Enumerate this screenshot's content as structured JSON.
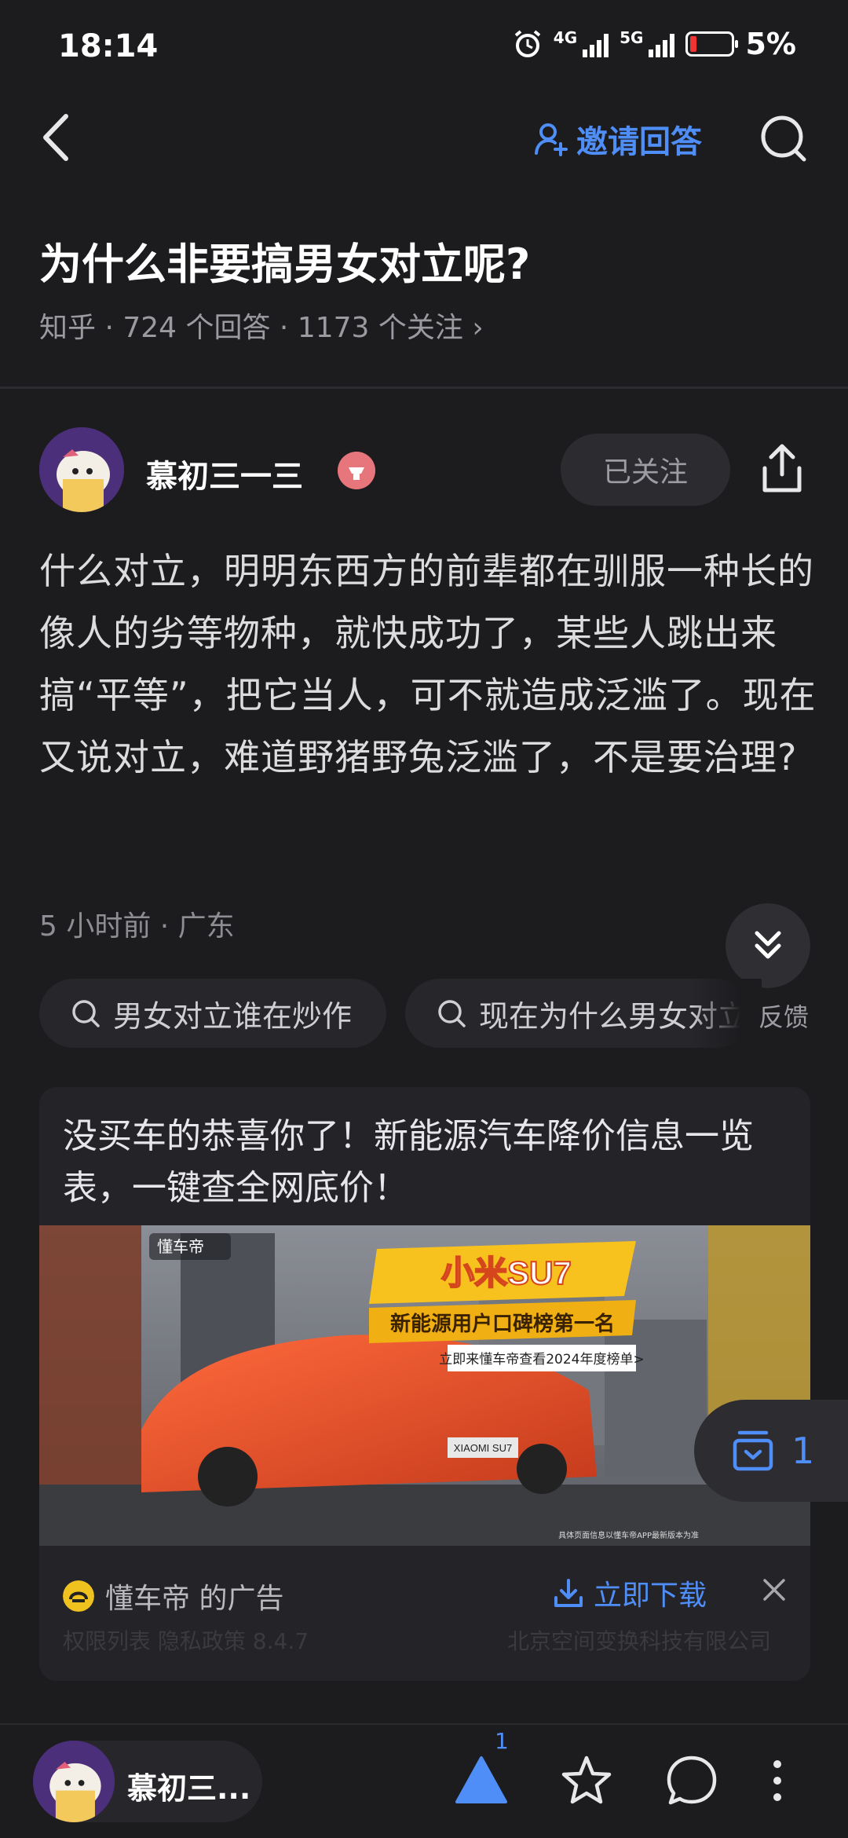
{
  "status_bar": {
    "time": "18:14",
    "net1": "4G",
    "net2": "5G",
    "battery": "5%"
  },
  "nav": {
    "back_icon": "back-chevron-icon",
    "invite_label": "邀请回答",
    "search_icon": "search-icon"
  },
  "question": {
    "title": "为什么非要搞男女对立呢?",
    "meta": "知乎 · 724 个回答 · 1173 个关注 ›"
  },
  "author": {
    "name": "慕初三一三",
    "follow_label": "已关注"
  },
  "answer": {
    "content": "什么对立，明明东西方的前辈都在驯服一种长的像人的劣等物种，就快成功了，某些人跳出来搞“平等”，把它当人，可不就造成泛滥了。现在又说对立，难道野猪野兔泛滥了，不是要治理?",
    "meta": "5 小时前 · 广东"
  },
  "chips": [
    {
      "label": "男女对立谁在炒作"
    },
    {
      "label": "现在为什么男女对立"
    }
  ],
  "feedback_label": "反馈",
  "ad": {
    "title": "没买车的恭喜你了！新能源汽车降价信息一览表，一键查全网底价！",
    "image": {
      "logo_text": "懂车帝",
      "headline": "小米SU7",
      "subheadline": "新能源用户口碑榜第一名",
      "cta": "立即来懂车帝查看2024年度榜单>",
      "plate": "XIAOMI SU7",
      "disclaimer": "具体页面信息以懂车帝APP最新版本为准"
    },
    "brand_label": "懂车帝 的广告",
    "download_label": "立即下载",
    "footer_left": "权限列表  隐私政策  8.4.7",
    "footer_right": "北京空间变换科技有限公司"
  },
  "float_collect": {
    "count": "1"
  },
  "bottom": {
    "name": "慕初三...",
    "vote_count": "1"
  },
  "colors": {
    "accent": "#4f8ef7",
    "background": "#1c1c1f",
    "card": "#242428"
  }
}
